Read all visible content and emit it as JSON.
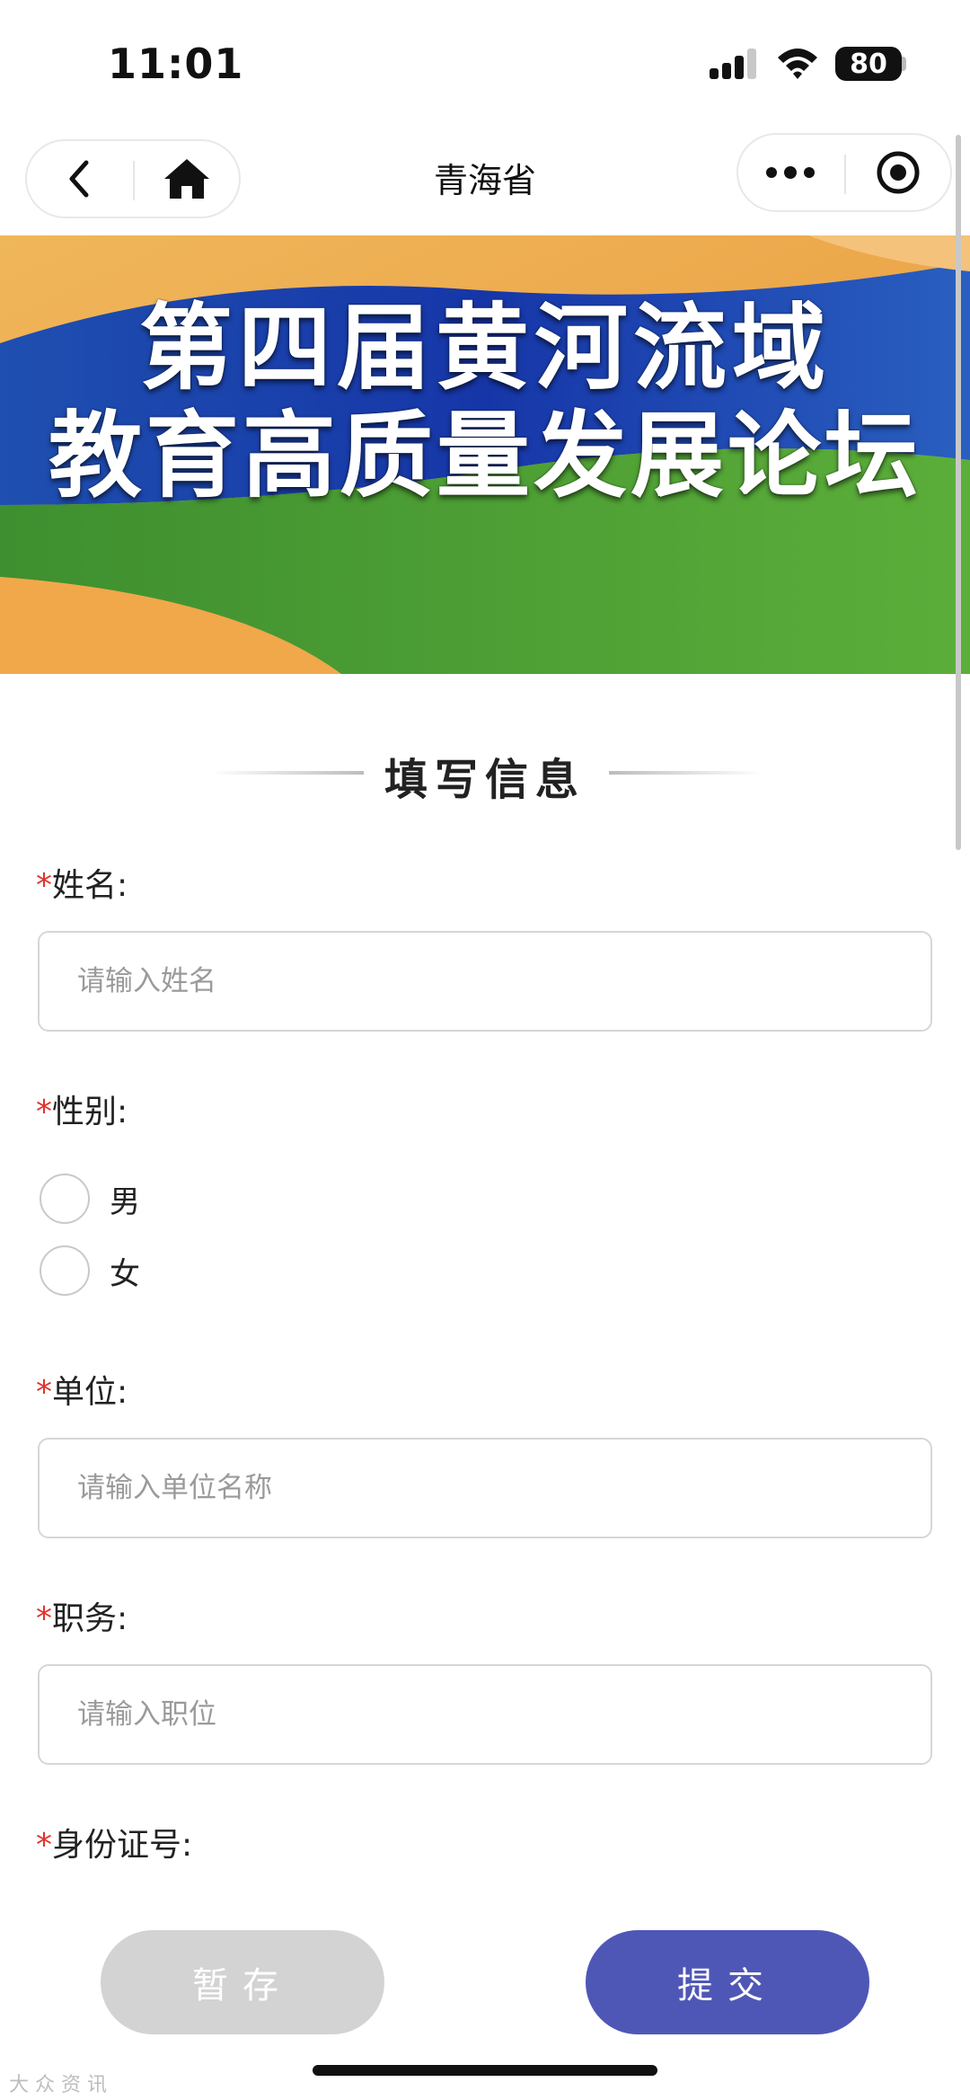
{
  "status_bar": {
    "time": "11:01",
    "battery": "80"
  },
  "nav": {
    "title": "青海省"
  },
  "banner": {
    "line1": "第四届黄河流域",
    "line2": "教育高质量发展论坛"
  },
  "section": {
    "title": "填写信息"
  },
  "form": {
    "required_mark": "*",
    "name": {
      "label": "姓名:",
      "placeholder": "请输入姓名"
    },
    "gender": {
      "label": "性别:",
      "options": [
        "男",
        "女"
      ]
    },
    "org": {
      "label": "单位:",
      "placeholder": "请输入单位名称"
    },
    "position": {
      "label": "职务:",
      "placeholder": "请输入职位"
    },
    "id_number": {
      "label": "身份证号:"
    }
  },
  "actions": {
    "save_label": "暂存",
    "submit_label": "提交"
  },
  "colors": {
    "accent": "#4f57b6",
    "required": "#e0332b",
    "disabled": "#d3d3d3"
  },
  "watermark": "大 众 资 讯"
}
